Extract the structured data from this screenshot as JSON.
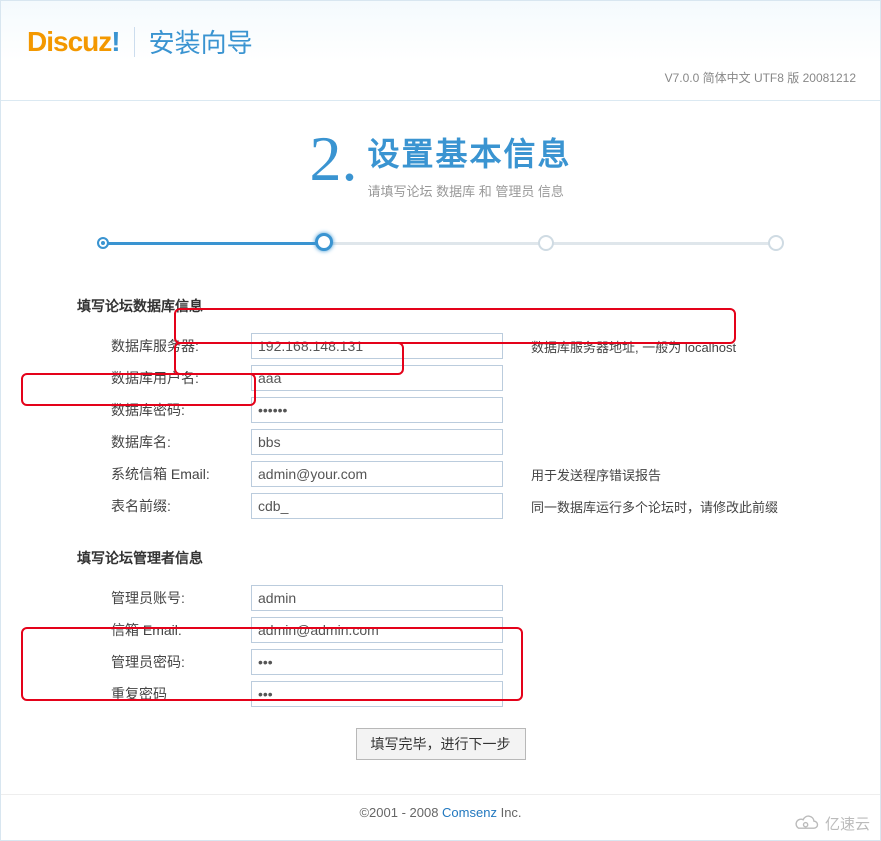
{
  "header": {
    "logo_first": "Discuz",
    "logo_exc": "!",
    "wizard_title": "安装向导",
    "version": "V7.0.0 简体中文 UTF8 版 20081212"
  },
  "step": {
    "number": "2.",
    "title": "设置基本信息",
    "subtitle": "请填写论坛 数据库 和 管理员 信息"
  },
  "section1": {
    "title": "填写论坛数据库信息",
    "rows": {
      "db_server": {
        "label": "数据库服务器:",
        "value": "192.168.148.131",
        "hint": "数据库服务器地址, 一般为 localhost"
      },
      "db_user": {
        "label": "数据库用户名:",
        "value": "aaa",
        "hint": ""
      },
      "db_pass": {
        "label": "数据库密码:",
        "value": "aaaaaa",
        "hint": ""
      },
      "db_name": {
        "label": "数据库名:",
        "value": "bbs",
        "hint": ""
      },
      "sys_email": {
        "label": "系统信箱 Email:",
        "value": "admin@your.com",
        "hint": "用于发送程序错误报告"
      },
      "tbl_prefix": {
        "label": "表名前缀:",
        "value": "cdb_",
        "hint": "同一数据库运行多个论坛时，请修改此前缀"
      }
    }
  },
  "section2": {
    "title": "填写论坛管理者信息",
    "rows": {
      "admin_user": {
        "label": "管理员账号:",
        "value": "admin"
      },
      "admin_email": {
        "label": "信箱 Email:",
        "value": "admin@admin.com"
      },
      "admin_pass": {
        "label": "管理员密码:",
        "value": "aaa"
      },
      "admin_pass2": {
        "label": "重复密码",
        "value": "aaa"
      }
    }
  },
  "submit": {
    "label": "填写完毕，进行下一步"
  },
  "footer": {
    "copy_pre": "©2001 - 2008 ",
    "link": "Comsenz",
    "copy_post": " Inc."
  },
  "watermark": {
    "text": "亿速云"
  }
}
